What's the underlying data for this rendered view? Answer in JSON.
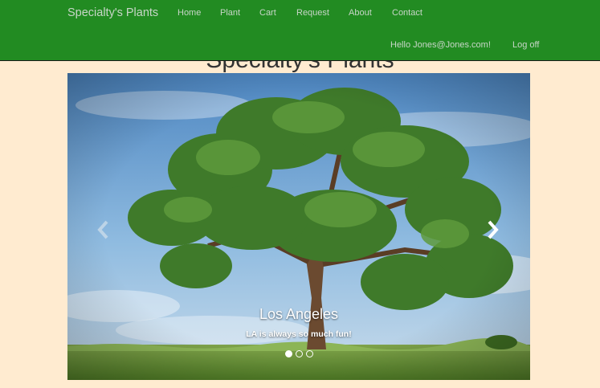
{
  "nav": {
    "brand": "Specialty's Plants",
    "links": [
      "Home",
      "Plant",
      "Cart",
      "Request",
      "About",
      "Contact"
    ],
    "greeting": "Hello Jones@Jones.com!",
    "logoff": "Log off"
  },
  "page": {
    "heading": "Specialty's Plants"
  },
  "carousel": {
    "slide_title": "Los Angeles",
    "slide_caption": "LA is always so much fun!",
    "slide_count": 3,
    "active_index": 0,
    "image": "tree in grassy field under blue sky",
    "prev_icon": "chevron-left-icon",
    "next_icon": "chevron-right-icon"
  },
  "colors": {
    "navbar": "#228b22",
    "nav_text": "#c8d6c8",
    "background": "#ffebd0"
  }
}
